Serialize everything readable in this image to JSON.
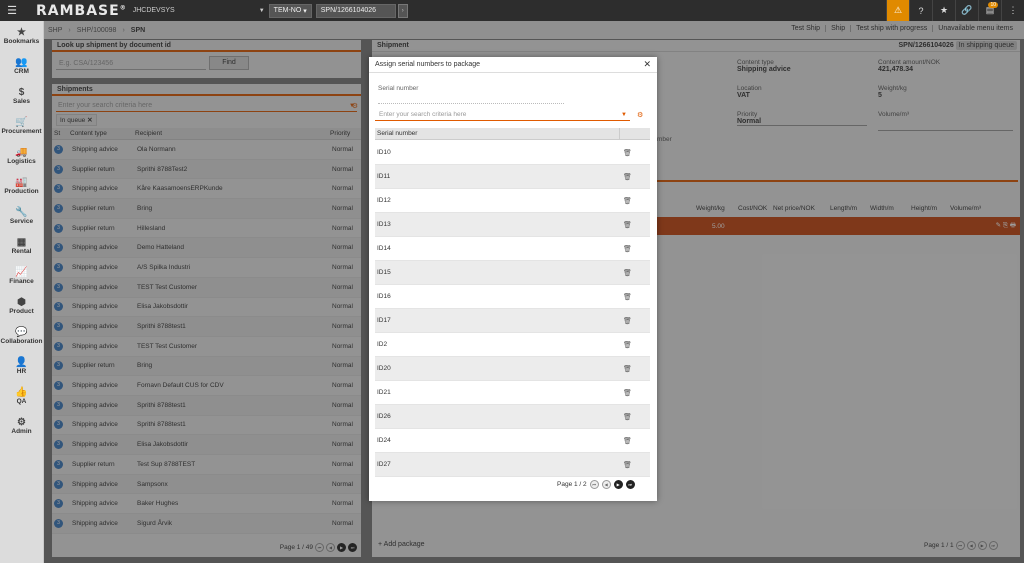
{
  "topbar": {
    "brand": "RAMBASE",
    "system": "JHCDEVSYS",
    "company": "TEM-NO",
    "document": "SPN/1266104026",
    "notifications_count": "10",
    "icons": [
      "warning-icon",
      "help-icon",
      "star-icon",
      "link-icon",
      "notification-icon",
      "user-menu-icon"
    ]
  },
  "sidebar": {
    "items": [
      {
        "label": "Bookmarks",
        "icon": "★"
      },
      {
        "label": "CRM",
        "icon": "👥"
      },
      {
        "label": "Sales",
        "icon": "$"
      },
      {
        "label": "Procurement",
        "icon": "🛒"
      },
      {
        "label": "Logistics",
        "icon": "🚚"
      },
      {
        "label": "Production",
        "icon": "🏭"
      },
      {
        "label": "Service",
        "icon": "🔧"
      },
      {
        "label": "Rental",
        "icon": "▦"
      },
      {
        "label": "Finance",
        "icon": "📈"
      },
      {
        "label": "Product",
        "icon": "⬢"
      },
      {
        "label": "Collaboration",
        "icon": "💬"
      },
      {
        "label": "HR",
        "icon": "👤"
      },
      {
        "label": "QA",
        "icon": "👍"
      },
      {
        "label": "Admin",
        "icon": "⚙"
      }
    ]
  },
  "breadcrumb": {
    "items": [
      "SHP",
      "SHP/100098",
      "SPN"
    ]
  },
  "actions": [
    "Test Ship",
    "Ship",
    "Test ship with progress",
    "Unavailable menu items"
  ],
  "lookup": {
    "title": "Look up shipment by document id",
    "placeholder": "E.g. CSA/123456",
    "button": "Find"
  },
  "shipments": {
    "title": "Shipments",
    "search_placeholder": "Enter your search criteria here",
    "filter_chip": "In queue",
    "columns": [
      "St",
      "Content type",
      "Recipient",
      "Priority"
    ],
    "rows": [
      {
        "st": "3",
        "type": "Shipping advice",
        "recipient": "Ola Normann",
        "priority": "Normal"
      },
      {
        "st": "3",
        "type": "Supplier return",
        "recipient": "Sprithi 8788Test2",
        "priority": "Normal"
      },
      {
        "st": "3",
        "type": "Shipping advice",
        "recipient": "Kåre KaasamoensERPKunde",
        "priority": "Normal"
      },
      {
        "st": "3",
        "type": "Supplier return",
        "recipient": "Bring",
        "priority": "Normal"
      },
      {
        "st": "3",
        "type": "Supplier return",
        "recipient": "Hillesland",
        "priority": "Normal"
      },
      {
        "st": "3",
        "type": "Shipping advice",
        "recipient": "Demo Hatteland",
        "priority": "Normal"
      },
      {
        "st": "3",
        "type": "Shipping advice",
        "recipient": "A/S Spilka Industri",
        "priority": "Normal"
      },
      {
        "st": "3",
        "type": "Shipping advice",
        "recipient": "TEST Test Customer",
        "priority": "Normal"
      },
      {
        "st": "3",
        "type": "Shipping advice",
        "recipient": "Elisa Jakobsdottir",
        "priority": "Normal"
      },
      {
        "st": "3",
        "type": "Shipping advice",
        "recipient": "Sprithi 8788test1",
        "priority": "Normal"
      },
      {
        "st": "3",
        "type": "Shipping advice",
        "recipient": "TEST Test Customer",
        "priority": "Normal"
      },
      {
        "st": "3",
        "type": "Supplier return",
        "recipient": "Bring",
        "priority": "Normal"
      },
      {
        "st": "3",
        "type": "Shipping advice",
        "recipient": "Fornavn Default CUS for CDV",
        "priority": "Normal"
      },
      {
        "st": "3",
        "type": "Shipping advice",
        "recipient": "Sprithi 8788test1",
        "priority": "Normal"
      },
      {
        "st": "3",
        "type": "Shipping advice",
        "recipient": "Sprithi 8788test1",
        "priority": "Normal"
      },
      {
        "st": "3",
        "type": "Shipping advice",
        "recipient": "Elisa Jakobsdottir",
        "priority": "Normal"
      },
      {
        "st": "3",
        "type": "Supplier return",
        "recipient": "Test Sup 8788TEST",
        "priority": "Normal"
      },
      {
        "st": "3",
        "type": "Shipping advice",
        "recipient": "Sampsonx",
        "priority": "Normal"
      },
      {
        "st": "3",
        "type": "Shipping advice",
        "recipient": "Baker Hughes",
        "priority": "Normal"
      },
      {
        "st": "3",
        "type": "Shipping advice",
        "recipient": "Sigurd Årvik",
        "priority": "Normal"
      }
    ],
    "pager": "Page 1 / 49"
  },
  "shipment": {
    "title": "Shipment",
    "doc": "SPN/1266104026",
    "status": "In shipping queue",
    "fields": {
      "content_type_label": "Content type",
      "content_type": "Shipping advice",
      "amount_label": "Content amount/NOK",
      "amount": "421,478.34",
      "location_label": "Location",
      "location": "VAT",
      "weight_label": "Weight/kg",
      "weight": "5",
      "priority_label": "Priority",
      "priority": "Normal",
      "volume_label": "Volume/m³",
      "number_label": "mber"
    },
    "packages_columns": [
      "Weight/kg",
      "Cost/NOK",
      "Net price/NOK",
      "Length/m",
      "Width/m",
      "Height/m",
      "Volume/m³"
    ],
    "package_weight": "5.00",
    "add_package": "+ Add package",
    "pager": "Page 1 / 1"
  },
  "modal": {
    "title": "Assign serial numbers to package",
    "serial_label": "Serial number",
    "search_placeholder": "Enter your search criteria here",
    "column": "Serial number",
    "rows": [
      "ID10",
      "ID11",
      "ID12",
      "ID13",
      "ID14",
      "ID15",
      "ID16",
      "ID17",
      "ID2",
      "ID20",
      "ID21",
      "ID26",
      "ID24",
      "ID27"
    ],
    "pager": "Page 1 / 2"
  }
}
